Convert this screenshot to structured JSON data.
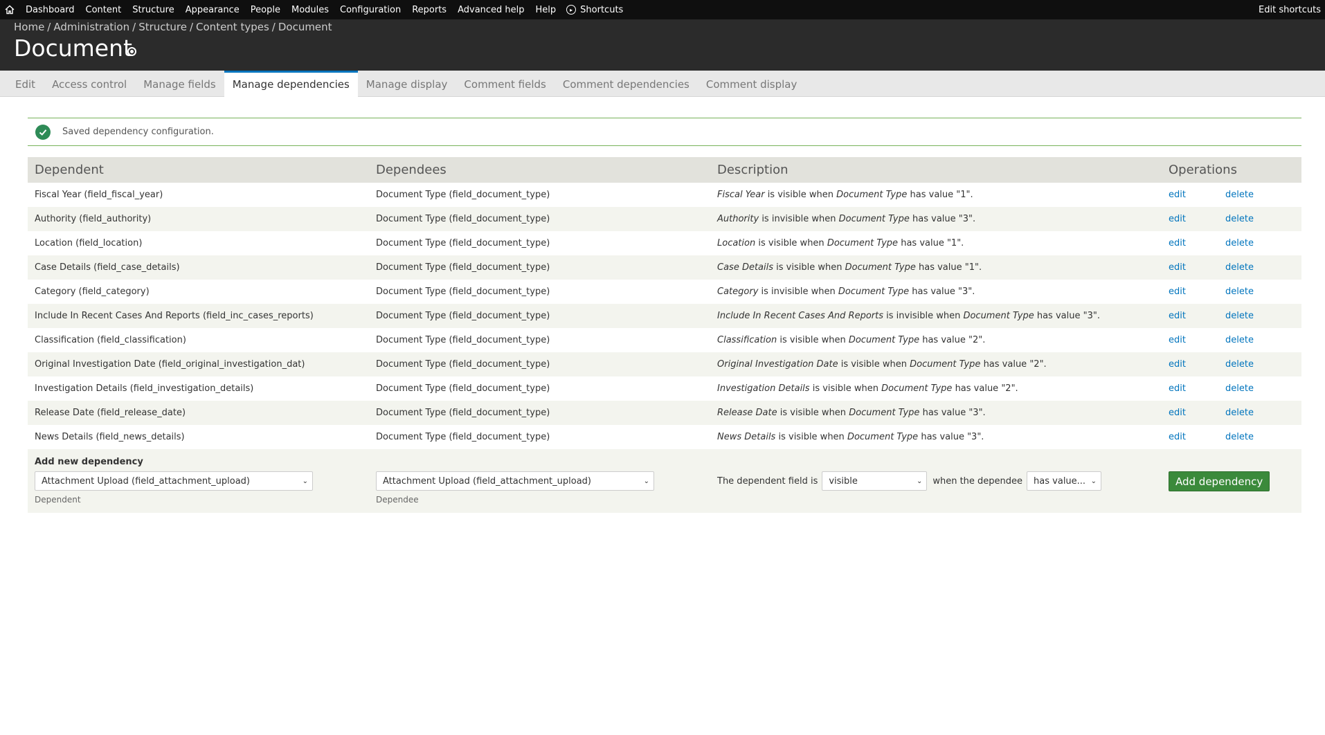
{
  "toolbar": {
    "items": [
      "Dashboard",
      "Content",
      "Structure",
      "Appearance",
      "People",
      "Modules",
      "Configuration",
      "Reports",
      "Advanced help",
      "Help"
    ],
    "shortcuts_label": "Shortcuts",
    "edit_shortcuts_label": "Edit shortcuts"
  },
  "breadcrumb": [
    "Home",
    "Administration",
    "Structure",
    "Content types",
    "Document"
  ],
  "page_title": "Document",
  "tabs": [
    {
      "label": "Edit",
      "active": false
    },
    {
      "label": "Access control",
      "active": false
    },
    {
      "label": "Manage fields",
      "active": false
    },
    {
      "label": "Manage dependencies",
      "active": true
    },
    {
      "label": "Manage display",
      "active": false
    },
    {
      "label": "Comment fields",
      "active": false
    },
    {
      "label": "Comment dependencies",
      "active": false
    },
    {
      "label": "Comment display",
      "active": false
    }
  ],
  "message": "Saved dependency configuration.",
  "table": {
    "headers": [
      "Dependent",
      "Dependees",
      "Description",
      "Operations"
    ],
    "rows": [
      {
        "dependent": "Fiscal Year (field_fiscal_year)",
        "dependee": "Document Type (field_document_type)",
        "desc_field": "Fiscal Year",
        "desc_state": "is visible when",
        "desc_dependee": "Document Type",
        "desc_value": "has value \"1\"."
      },
      {
        "dependent": "Authority (field_authority)",
        "dependee": "Document Type (field_document_type)",
        "desc_field": "Authority",
        "desc_state": "is invisible when",
        "desc_dependee": "Document Type",
        "desc_value": "has value \"3\"."
      },
      {
        "dependent": "Location (field_location)",
        "dependee": "Document Type (field_document_type)",
        "desc_field": "Location",
        "desc_state": "is visible when",
        "desc_dependee": "Document Type",
        "desc_value": "has value \"1\"."
      },
      {
        "dependent": "Case Details (field_case_details)",
        "dependee": "Document Type (field_document_type)",
        "desc_field": "Case Details",
        "desc_state": "is visible when",
        "desc_dependee": "Document Type",
        "desc_value": "has value \"1\"."
      },
      {
        "dependent": "Category (field_category)",
        "dependee": "Document Type (field_document_type)",
        "desc_field": "Category",
        "desc_state": "is invisible when",
        "desc_dependee": "Document Type",
        "desc_value": "has value \"3\"."
      },
      {
        "dependent": "Include In Recent Cases And Reports (field_inc_cases_reports)",
        "dependee": "Document Type (field_document_type)",
        "desc_field": "Include In Recent Cases And Reports",
        "desc_state": "is invisible when",
        "desc_dependee": "Document Type",
        "desc_value": "has value \"3\"."
      },
      {
        "dependent": "Classification (field_classification)",
        "dependee": "Document Type (field_document_type)",
        "desc_field": "Classification",
        "desc_state": "is visible when",
        "desc_dependee": "Document Type",
        "desc_value": "has value \"2\"."
      },
      {
        "dependent": "Original Investigation Date (field_original_investigation_dat)",
        "dependee": "Document Type (field_document_type)",
        "desc_field": "Original Investigation Date",
        "desc_state": "is visible when",
        "desc_dependee": "Document Type",
        "desc_value": "has value \"2\"."
      },
      {
        "dependent": "Investigation Details (field_investigation_details)",
        "dependee": "Document Type (field_document_type)",
        "desc_field": "Investigation Details",
        "desc_state": "is visible when",
        "desc_dependee": "Document Type",
        "desc_value": "has value \"2\"."
      },
      {
        "dependent": "Release Date (field_release_date)",
        "dependee": "Document Type (field_document_type)",
        "desc_field": "Release Date",
        "desc_state": "is visible when",
        "desc_dependee": "Document Type",
        "desc_value": "has value \"3\"."
      },
      {
        "dependent": "News Details (field_news_details)",
        "dependee": "Document Type (field_document_type)",
        "desc_field": "News Details",
        "desc_state": "is visible when",
        "desc_dependee": "Document Type",
        "desc_value": "has value \"3\"."
      }
    ],
    "edit_label": "edit",
    "delete_label": "delete"
  },
  "add_new": {
    "title": "Add new dependency",
    "dependent_value": "Attachment Upload (field_attachment_upload)",
    "dependent_desc": "Dependent",
    "dependee_value": "Attachment Upload (field_attachment_upload)",
    "dependee_desc": "Dependee",
    "prefix": "The dependent field is",
    "state_value": "visible",
    "middle": "when the dependee",
    "condition_value": "has value...",
    "button_label": "Add dependency"
  },
  "colors": {
    "accent": "#0074bd",
    "button": "#3b8a3b",
    "toolbar": "#0f0f0f",
    "header": "#2b2b2b",
    "message_border": "#77b259"
  }
}
